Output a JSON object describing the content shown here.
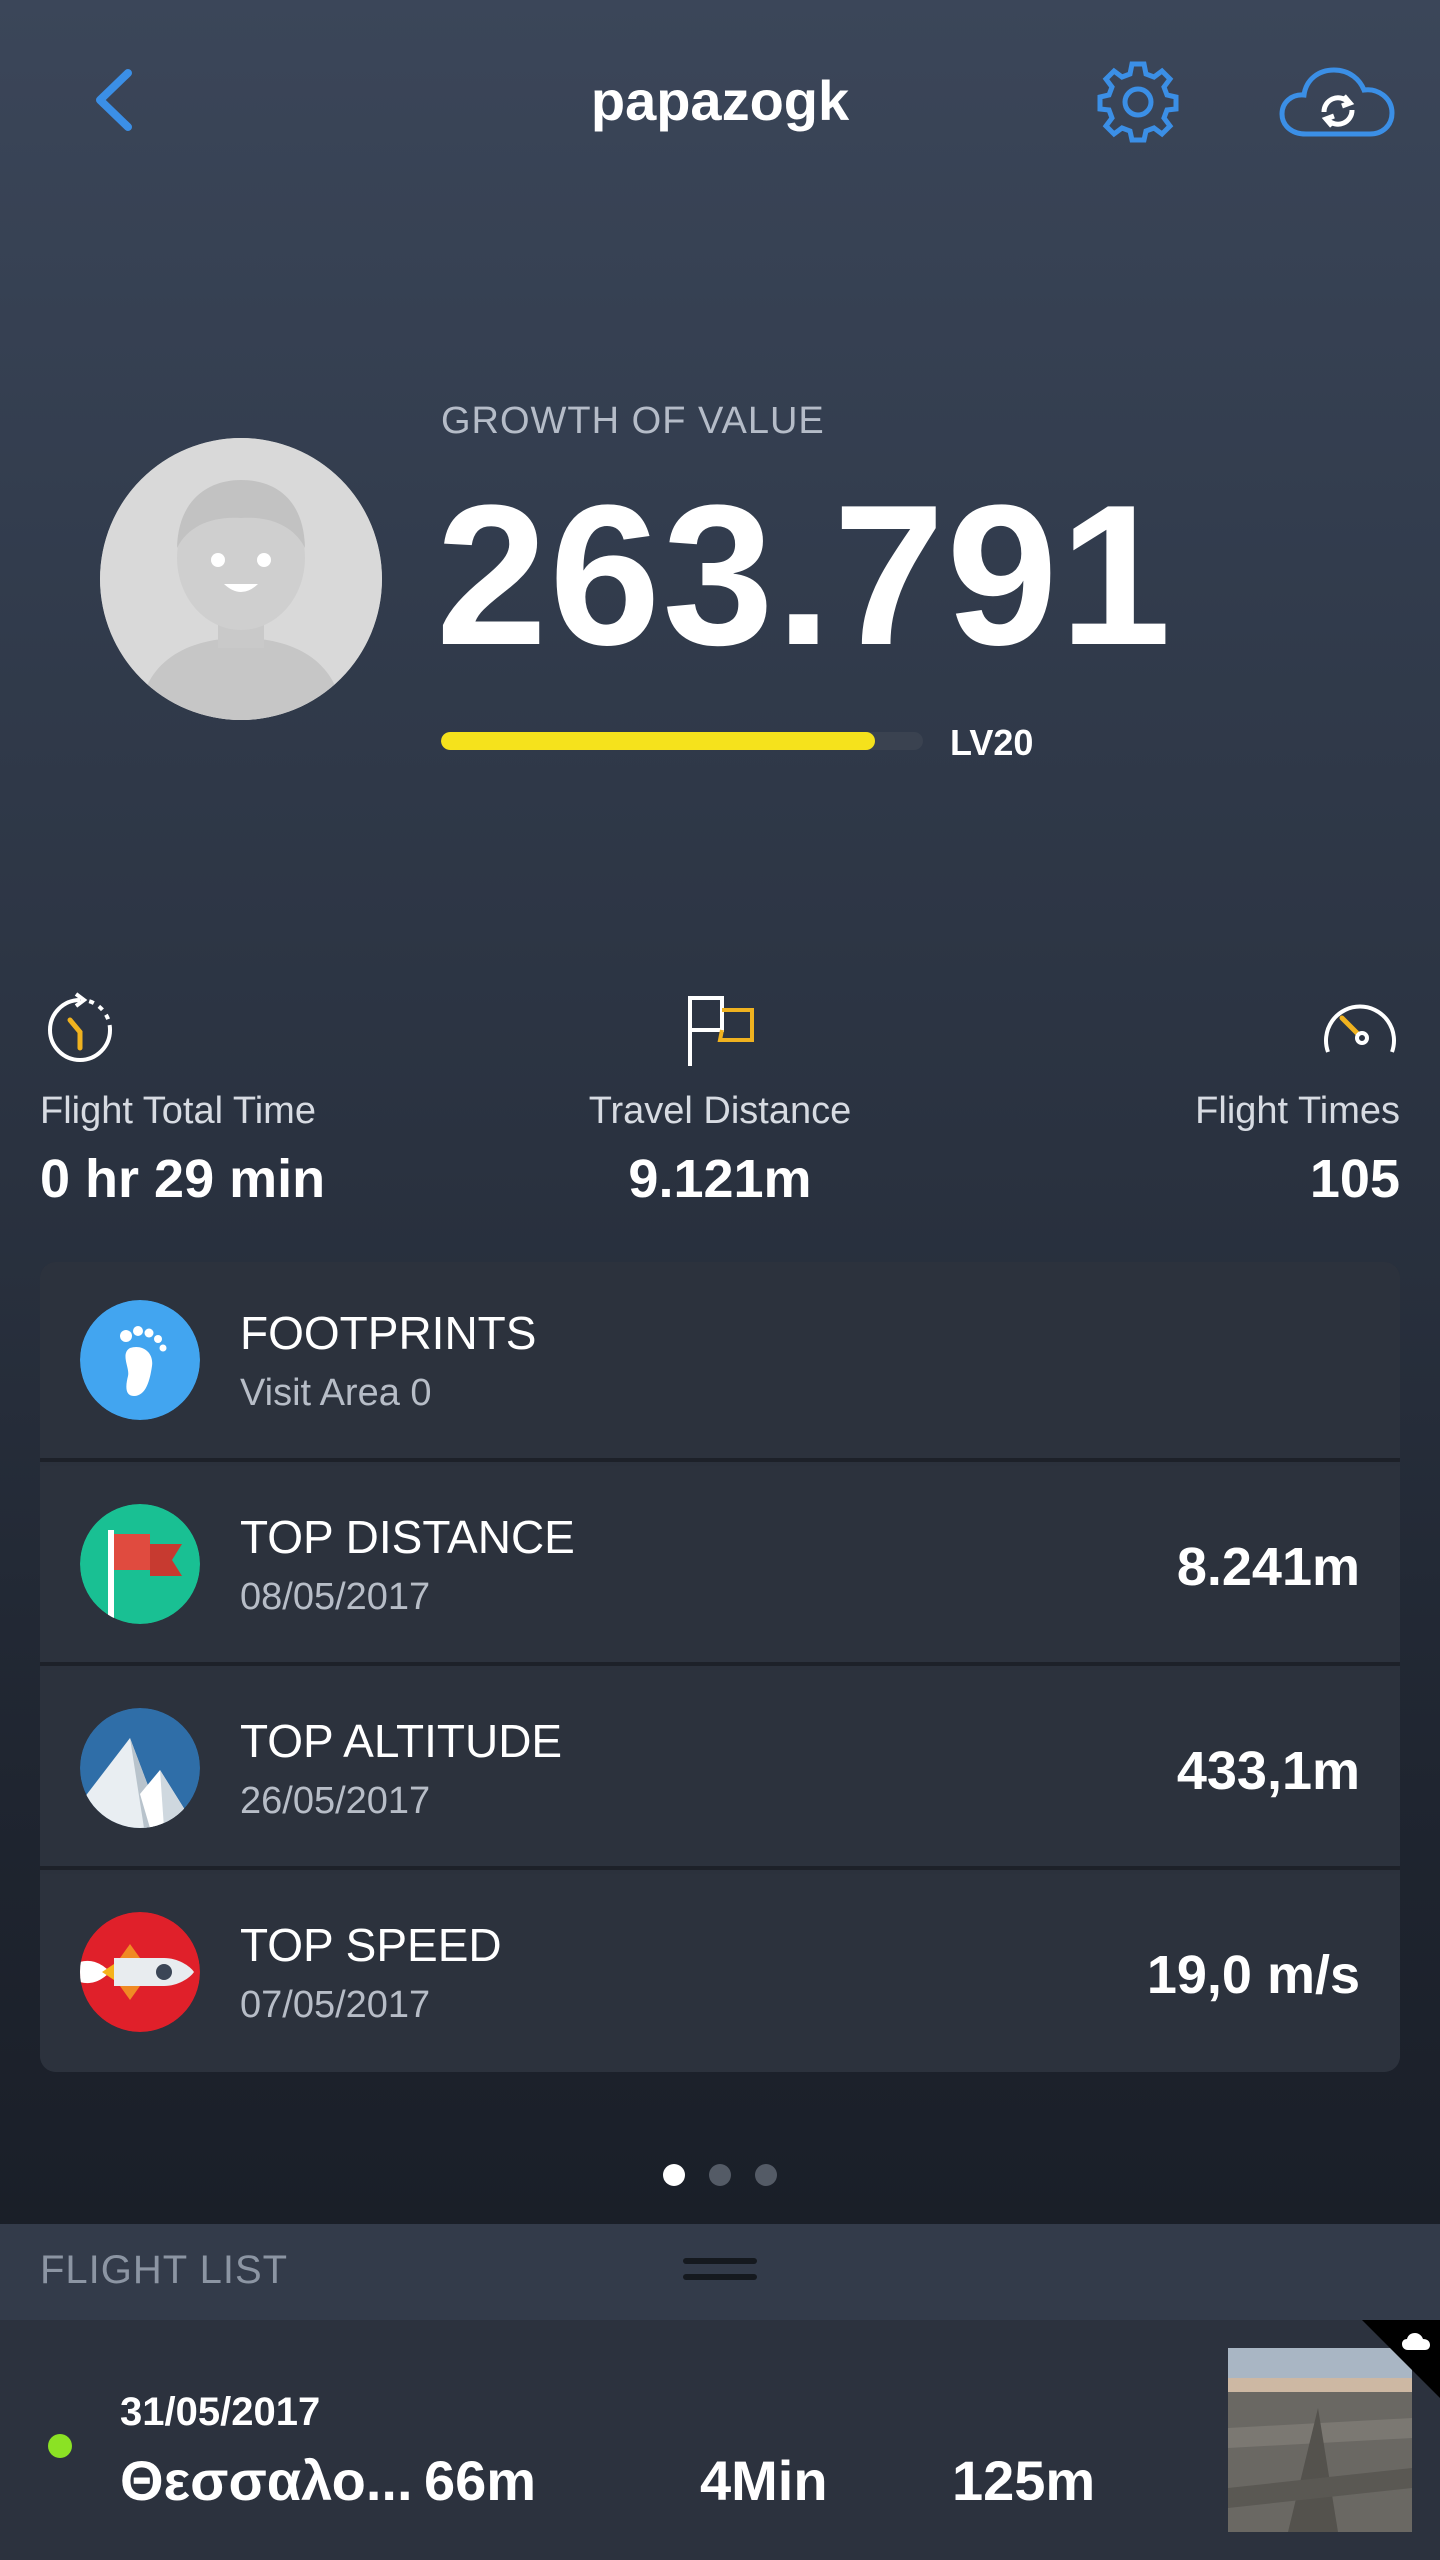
{
  "header": {
    "title": "papazogk"
  },
  "profile": {
    "growth_label": "GROWTH OF VALUE",
    "growth_value": "263.791",
    "level_label": "LV20",
    "level_progress": 0.9
  },
  "stats": [
    {
      "label": "Flight Total Time",
      "value": "0 hr 29 min",
      "icon": "stopwatch-icon"
    },
    {
      "label": "Travel Distance",
      "value": "9.121m",
      "icon": "flag-icon"
    },
    {
      "label": "Flight Times",
      "value": "105",
      "icon": "speedometer-icon"
    }
  ],
  "records": [
    {
      "title": "FOOTPRINTS",
      "subtitle": "Visit Area 0",
      "value": "",
      "icon": "footprint-icon",
      "color": "#42a5f0"
    },
    {
      "title": "TOP DISTANCE",
      "subtitle": "08/05/2017",
      "value": "8.241m",
      "icon": "red-flag-icon",
      "color": "#19c093"
    },
    {
      "title": "TOP ALTITUDE",
      "subtitle": "26/05/2017",
      "value": "433,1m",
      "icon": "mountain-icon",
      "color": "#2f6ea8"
    },
    {
      "title": "TOP SPEED",
      "subtitle": "07/05/2017",
      "value": "19,0 m/s",
      "icon": "rocket-icon",
      "color": "#e0202a"
    }
  ],
  "pager": {
    "pages": 3,
    "active": 1
  },
  "flight_list": {
    "header_label": "FLIGHT LIST",
    "items": [
      {
        "date": "31/05/2017",
        "place": "Θεσσαλο...",
        "distance": "66m",
        "duration": "4Min",
        "altitude": "125m",
        "status_color": "#8be224"
      }
    ]
  },
  "colors": {
    "accent": "#3b8fe6",
    "level_bar": "#f5e21c"
  }
}
